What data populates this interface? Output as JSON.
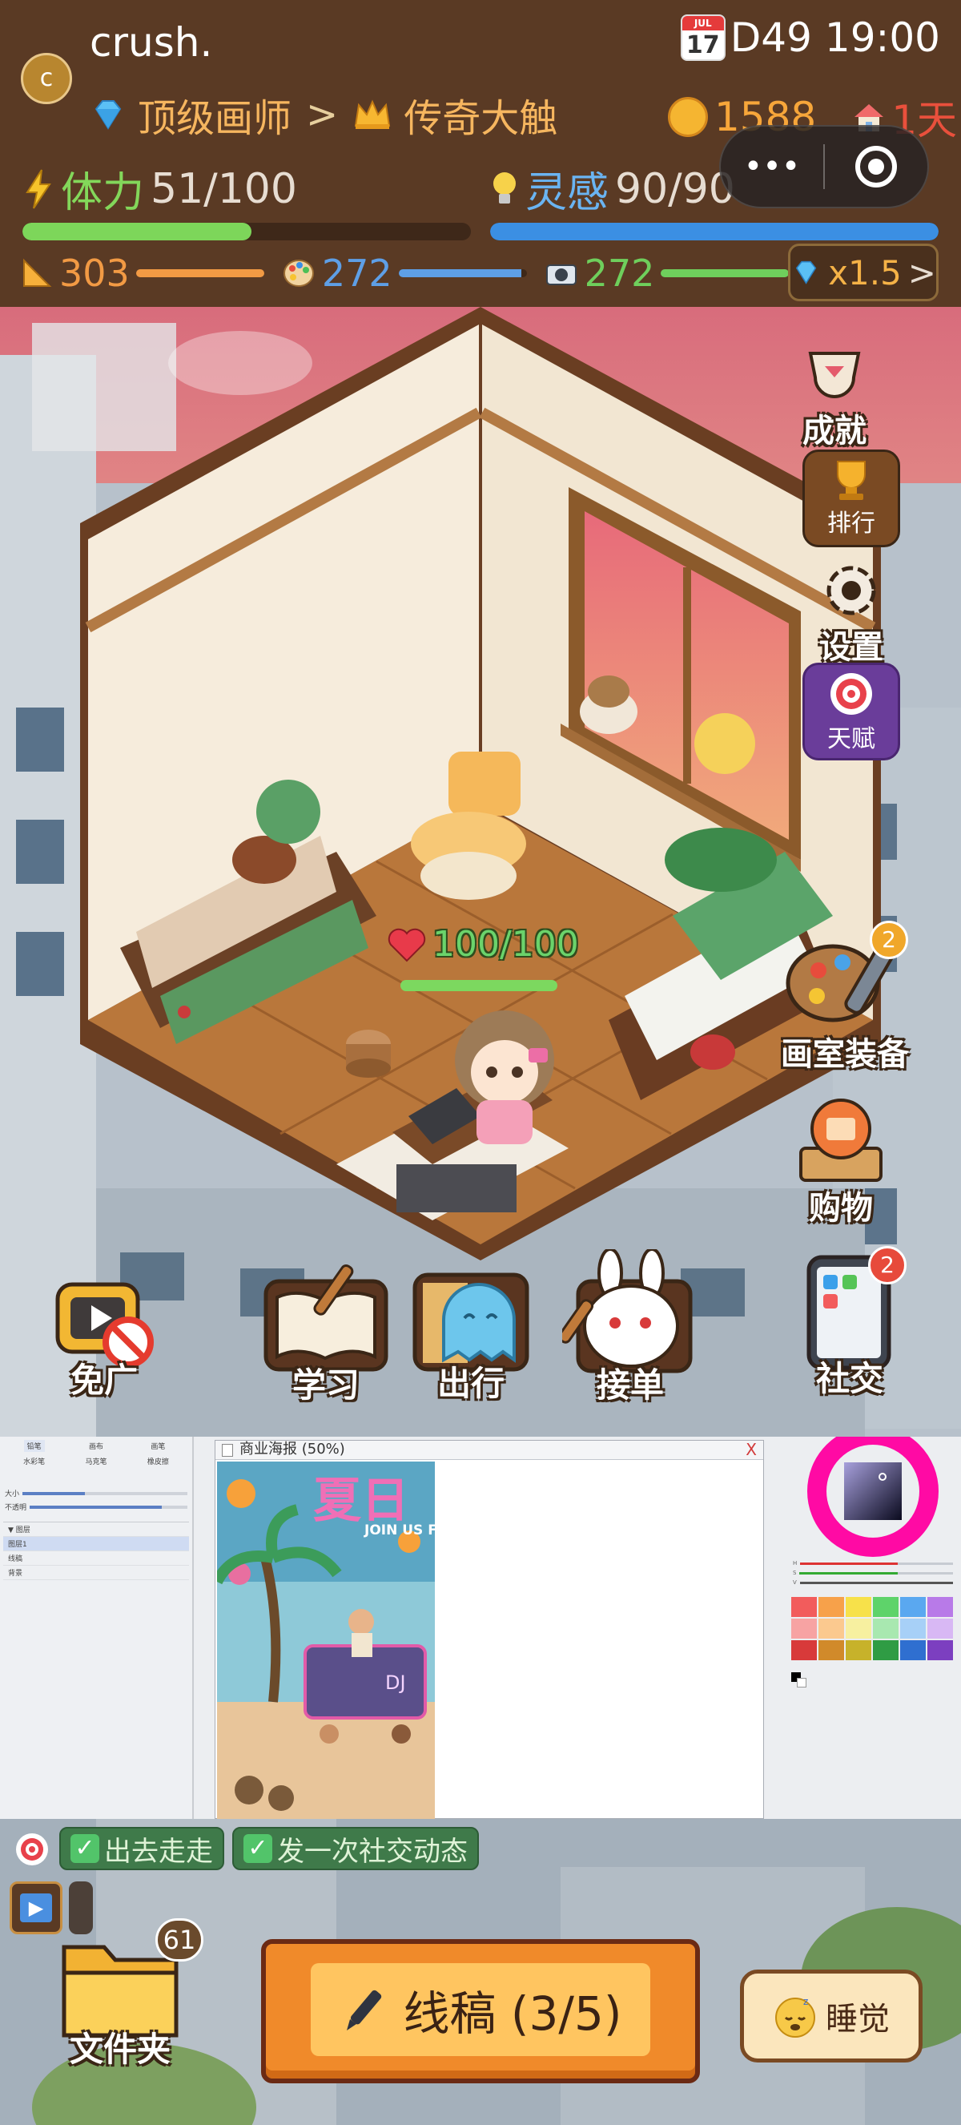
{
  "header": {
    "avatar_letter": "c",
    "username": "crush.",
    "rank_from": "顶级画师",
    "rank_sep": ">",
    "rank_to": "传奇大触",
    "calendar_month": "JUL",
    "calendar_day": "17",
    "day_label": "D49",
    "time": "19:00",
    "coins": "1588",
    "days": "1天",
    "menu_dots": "•••",
    "stamina_label": "体力",
    "stamina_value": "51/100",
    "stamina_fraction": 0.51,
    "inspiration_label": "灵感",
    "inspiration_value": "90/90",
    "inspiration_fraction": 1.0,
    "stat_ruler": "303",
    "stat_palette": "272",
    "stat_camera": "272",
    "multiplier": "x1.5",
    "multiplier_arrow": ">",
    "colors": {
      "stamina": "#7dd65a",
      "inspiration": "#3b8fe3",
      "ruler": "#f29a44",
      "palette": "#5e9fe6",
      "camera": "#6fcf5c"
    }
  },
  "side_menu": {
    "achievements": "成就",
    "ranking": "排行",
    "settings": "设置",
    "talent": "天赋",
    "studio_gear": "画室装备",
    "studio_gear_badge": "2",
    "shopping": "购物"
  },
  "character": {
    "hp_text": "100/100",
    "hp_fraction": 1.0
  },
  "bottom_actions": {
    "no_ads": "免广",
    "study": "学习",
    "travel": "出行",
    "orders": "接单",
    "social": "社交",
    "social_badge": "2"
  },
  "editor": {
    "tools": [
      "铅笔",
      "画布",
      "画笔"
    ],
    "tools2": [
      "水彩笔",
      "马克笔",
      "橡皮擦"
    ],
    "size_label": "大小",
    "opacity_label": "不透明",
    "layers_header": "▼ 图层",
    "layers": [
      "图层1",
      "线稿",
      "背景"
    ],
    "document_title": "商业海报 (50%)",
    "close": "X",
    "poster_title": "夏日",
    "poster_sub": "JOIN US F",
    "poster_dj": "DJ",
    "hsv": [
      "H",
      "S",
      "V"
    ]
  },
  "tasks": {
    "go_out": "出去走走",
    "post_social": "发一次社交动态"
  },
  "bottom_bar": {
    "folder_label": "文件夹",
    "folder_badge": "61",
    "main_action": "线稿 (3/5)",
    "sleep": "睡觉"
  }
}
